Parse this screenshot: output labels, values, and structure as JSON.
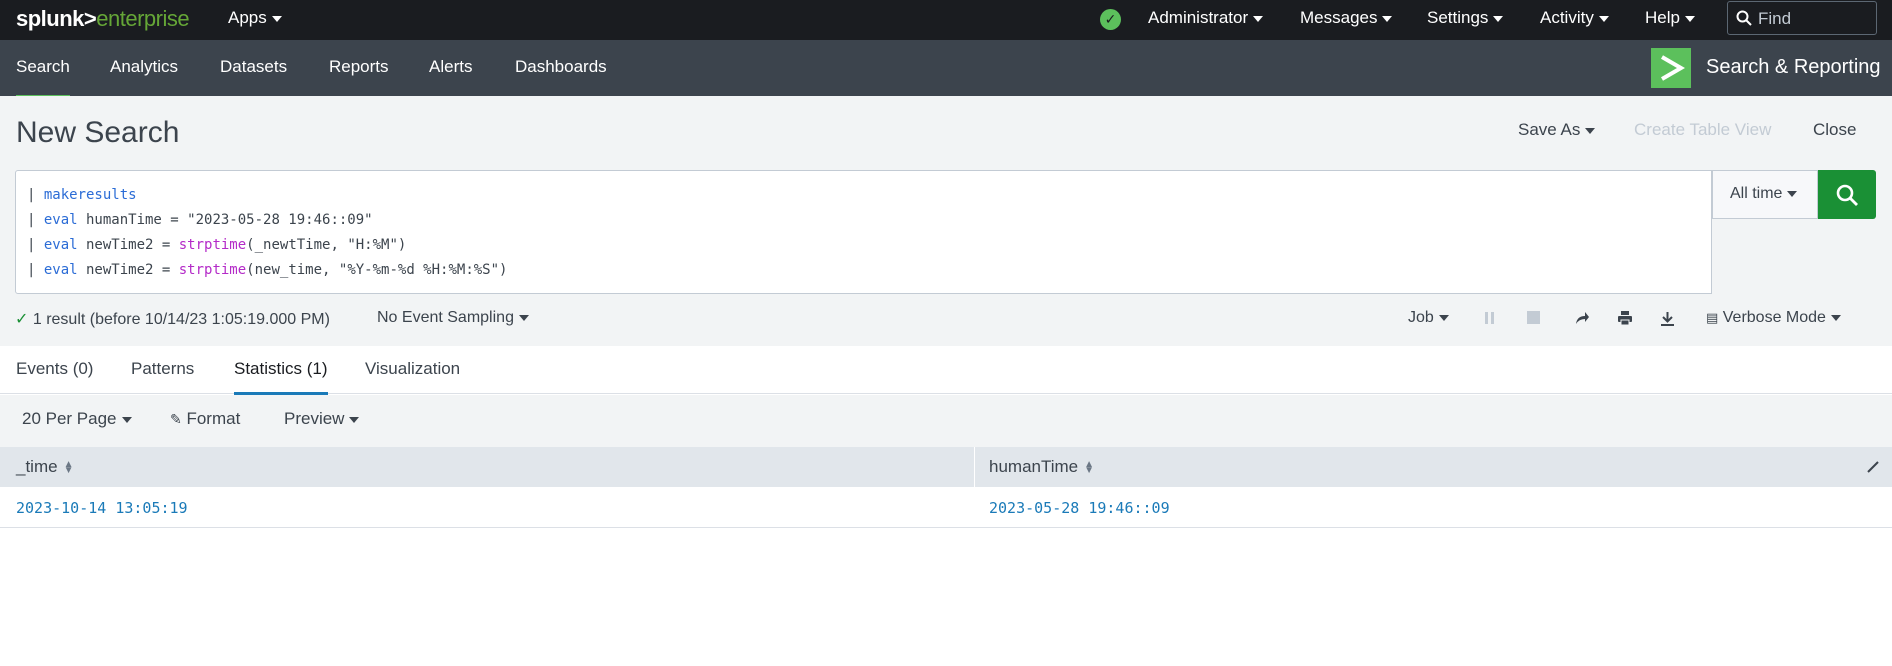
{
  "topbar": {
    "logo_word": "splunk>",
    "logo_suffix": "enterprise",
    "apps_label": "Apps",
    "menus": [
      "Administrator",
      "Messages",
      "Settings",
      "Activity",
      "Help"
    ],
    "find_placeholder": "Find"
  },
  "appbar": {
    "tabs": [
      "Search",
      "Analytics",
      "Datasets",
      "Reports",
      "Alerts",
      "Dashboards"
    ],
    "active_tab": "Search",
    "app_name": "Search & Reporting"
  },
  "search": {
    "page_title": "New Search",
    "save_as": "Save As",
    "create_table_view": "Create Table View",
    "close": "Close",
    "query_lines": [
      {
        "pipe": "| ",
        "cmd": "makeresults",
        "rest": ""
      },
      {
        "pipe": "| ",
        "cmd": "eval",
        "rest": " humanTime = \"2023-05-28 19:46::09\""
      },
      {
        "pipe": "| ",
        "cmd": "eval",
        "rest": " newTime2 = ",
        "fn": "strptime",
        "after": "(_newtTime, \"H:%M\")"
      },
      {
        "pipe": "| ",
        "cmd": "eval",
        "rest": " newTime2 = ",
        "fn": "strptime",
        "after": "(new_time, \"%Y-%m-%d %H:%M:%S\")"
      }
    ],
    "time_range": "All time",
    "result_status": "1 result (before 10/14/23 1:05:19.000 PM)",
    "sampling": "No Event Sampling",
    "job": "Job",
    "mode": "Verbose Mode"
  },
  "results": {
    "tabs": [
      "Events (0)",
      "Patterns",
      "Statistics (1)",
      "Visualization"
    ],
    "active_tab": "Statistics (1)",
    "per_page": "20 Per Page",
    "format": "Format",
    "preview": "Preview",
    "columns": [
      "_time",
      "humanTime"
    ],
    "rows": [
      [
        "2023-10-14 13:05:19",
        "2023-05-28 19:46::09"
      ]
    ]
  },
  "colors": {
    "topbar_bg": "#1a1c20",
    "appbar_bg": "#3c444d",
    "accent_green": "#5cc05c",
    "search_button": "#1a9035",
    "link_blue": "#1a7ab8"
  }
}
